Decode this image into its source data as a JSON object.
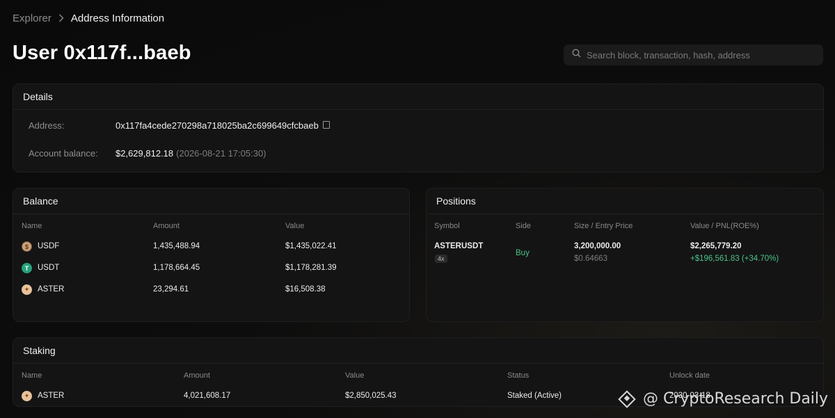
{
  "breadcrumb": {
    "root": "Explorer",
    "separator": ">",
    "current": "Address Information"
  },
  "title": "User 0x117f...baeb",
  "search": {
    "placeholder": "Search block, transaction, hash, address"
  },
  "details": {
    "heading": "Details",
    "address_label": "Address:",
    "address_value": "0x117fa4cede270298a718025ba2c699649cfcbaeb",
    "balance_label": "Account balance:",
    "balance_value": "$2,629,812.18",
    "balance_time": "(2026-08-21 17:05:30)"
  },
  "balance": {
    "heading": "Balance",
    "columns": [
      "Name",
      "Amount",
      "Value"
    ],
    "rows": [
      {
        "name": "USDF",
        "amount": "1,435,488.94",
        "value": "$1,435,022.41",
        "icon": "usdf-icon"
      },
      {
        "name": "USDT",
        "amount": "1,178,664.45",
        "value": "$1,178,281.39",
        "icon": "usdt-icon"
      },
      {
        "name": "ASTER",
        "amount": "23,294.61",
        "value": "$16,508.38",
        "icon": "aster-icon"
      }
    ]
  },
  "positions": {
    "heading": "Positions",
    "columns": [
      "Symbol",
      "Side",
      "Size / Entry Price",
      "Value / PNL(ROE%)"
    ],
    "rows": [
      {
        "symbol": "ASTERUSDT",
        "leverage": "4x",
        "side": "Buy",
        "size": "3,200,000.00",
        "entry": "$0.64663",
        "value": "$2,265,779.20",
        "pnl": "+$196,561.83 (+34.70%)"
      }
    ]
  },
  "staking": {
    "heading": "Staking",
    "columns": [
      "Name",
      "Amount",
      "Value",
      "Status",
      "Unlock date"
    ],
    "rows": [
      {
        "name": "ASTER",
        "amount": "4,021,608.17",
        "value": "$2,850,025.43",
        "status": "Staked (Active)",
        "unlock": "2030-03-18",
        "icon": "aster-icon"
      }
    ]
  },
  "watermark": "@ CryptoResearch Daily",
  "colors": {
    "positive": "#4cc38a",
    "background": "#0b0b0b",
    "card": "#141414"
  }
}
